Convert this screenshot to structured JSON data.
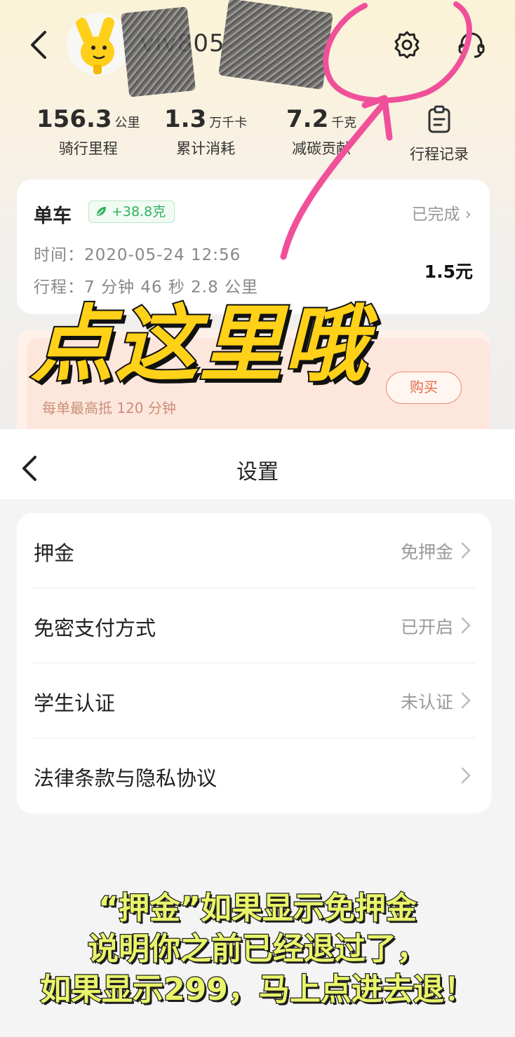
{
  "top": {
    "username": "viv805",
    "stats": [
      {
        "value": "156.3",
        "unit": "公里",
        "label": "骑行里程"
      },
      {
        "value": "1.3",
        "unit": "万千卡",
        "label": "累计消耗"
      },
      {
        "value": "7.2",
        "unit": "千克",
        "label": "减碳贡献"
      }
    ],
    "record_label": "行程记录",
    "trip": {
      "type": "单车",
      "carbon": "+38.8克",
      "status": "已完成",
      "time": "时间：2020-05-24 12:56",
      "route": "行程：7 分钟 46 秒 2.8 公里",
      "price": "1.5元"
    },
    "promo": {
      "text": "每单最高抵 120 分钟",
      "button": "购买"
    },
    "annotation": "点这里哦"
  },
  "settings": {
    "title": "设置",
    "rows": [
      {
        "label": "押金",
        "value": "免押金"
      },
      {
        "label": "免密支付方式",
        "value": "已开启"
      },
      {
        "label": "学生认证",
        "value": "未认证"
      },
      {
        "label": "法律条款与隐私协议",
        "value": ""
      }
    ]
  },
  "caption": {
    "line1": "“押金”如果显示免押金",
    "line2": "说明你之前已经退过了，",
    "line3": "如果显示299，马上点进去退！"
  },
  "colors": {
    "accent_pink": "#f0509a",
    "highlight_yellow": "#ffd118",
    "caption_green": "#e9f56a",
    "carbon_green": "#2fb35c"
  }
}
